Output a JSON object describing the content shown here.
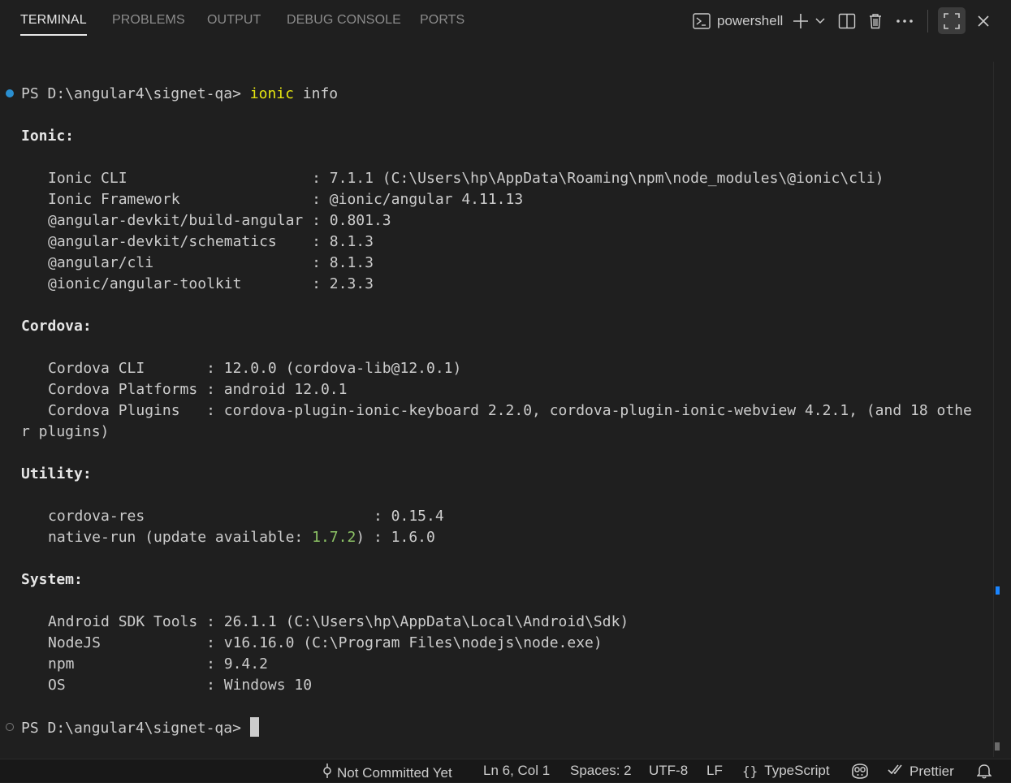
{
  "panel": {
    "tabs": [
      {
        "label": "TERMINAL",
        "active": true
      },
      {
        "label": "PROBLEMS",
        "active": false
      },
      {
        "label": "OUTPUT",
        "active": false
      },
      {
        "label": "DEBUG CONSOLE",
        "active": false
      },
      {
        "label": "PORTS",
        "active": false
      }
    ],
    "profile_label": "powershell",
    "icons": [
      "terminal-icon",
      "plus-icon",
      "chevron-down-icon",
      "split-icon",
      "trash-icon",
      "ellipsis-icon",
      "maximize-icon",
      "close-icon"
    ]
  },
  "terminal": {
    "prompt": "PS D:\\angular4\\signet-qa> ",
    "command_name": "ionic",
    "command_args": " info",
    "sections": {
      "ionic_header": "Ionic:",
      "ionic": [
        "Ionic CLI                     : 7.1.1 (C:\\Users\\hp\\AppData\\Roaming\\npm\\node_modules\\@ionic\\cli)",
        "Ionic Framework               : @ionic/angular 4.11.13",
        "@angular-devkit/build-angular : 0.801.3",
        "@angular-devkit/schematics    : 8.1.3",
        "@angular/cli                  : 8.1.3",
        "@ionic/angular-toolkit        : 2.3.3"
      ],
      "cordova_header": "Cordova:",
      "cordova": [
        "Cordova CLI       : 12.0.0 (cordova-lib@12.0.1)",
        "Cordova Platforms : android 12.0.1",
        "Cordova Plugins   : cordova-plugin-ionic-keyboard 2.2.0, cordova-plugin-ionic-webview 4.2.1, (and 18 othe"
      ],
      "cordova_wrap": "r plugins)",
      "utility_header": "Utility:",
      "utility_line1": "cordova-res                          : 0.15.4",
      "utility_line2_pre": "native-run (update available: ",
      "utility_line2_version": "1.7.2",
      "utility_line2_post": ") : 1.6.0",
      "system_header": "System:",
      "system": [
        "Android SDK Tools : 26.1.1 (C:\\Users\\hp\\AppData\\Local\\Android\\Sdk)",
        "NodeJS            : v16.16.0 (C:\\Program Files\\nodejs\\node.exe)",
        "npm               : 9.4.2",
        "OS                : Windows 10"
      ]
    },
    "final_prompt": "PS D:\\angular4\\signet-qa> "
  },
  "statusbar": {
    "scm": "Not Committed Yet",
    "position": "Ln 6, Col 1",
    "spaces": "Spaces: 2",
    "encoding": "UTF-8",
    "eol": "LF",
    "language": "TypeScript",
    "prettier": "Prettier"
  },
  "colors": {
    "background": "#1f1f1f",
    "command": "#e5e510",
    "update_version": "#8cc265",
    "decoration_success": "#2a8fd1"
  }
}
